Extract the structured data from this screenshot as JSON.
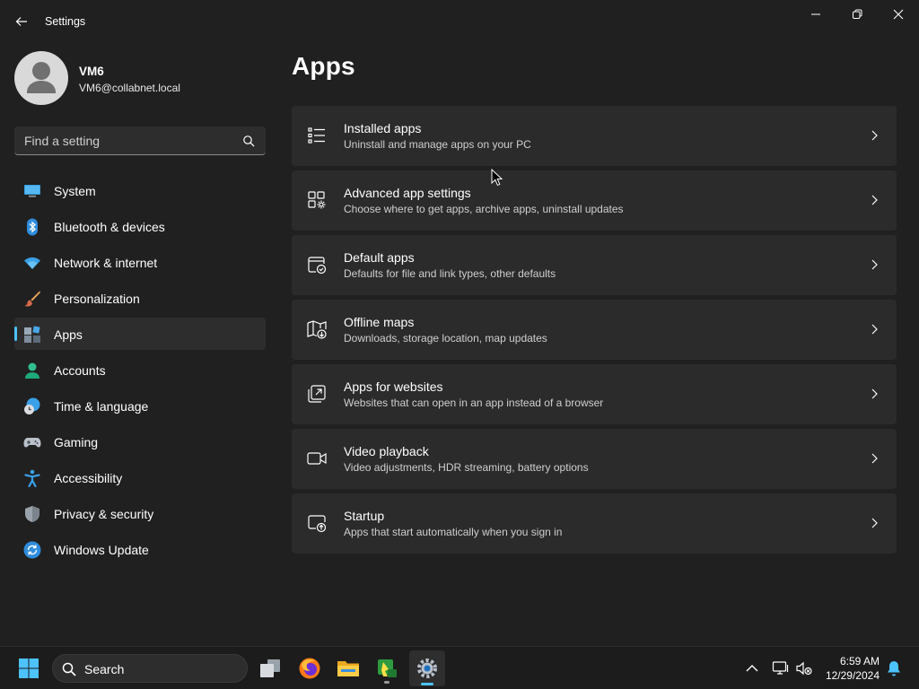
{
  "window": {
    "title": "Settings",
    "controls": [
      "minimize-icon",
      "restore-icon",
      "close-icon"
    ]
  },
  "profile": {
    "name": "VM6",
    "email": "VM6@collabnet.local"
  },
  "search": {
    "placeholder": "Find a setting"
  },
  "nav": {
    "items": [
      {
        "label": "System",
        "icon": "system-icon"
      },
      {
        "label": "Bluetooth & devices",
        "icon": "bluetooth-icon"
      },
      {
        "label": "Network & internet",
        "icon": "wifi-icon"
      },
      {
        "label": "Personalization",
        "icon": "paintbrush-icon"
      },
      {
        "label": "Apps",
        "icon": "apps-icon",
        "selected": true
      },
      {
        "label": "Accounts",
        "icon": "accounts-icon"
      },
      {
        "label": "Time & language",
        "icon": "time-language-icon"
      },
      {
        "label": "Gaming",
        "icon": "gamepad-icon"
      },
      {
        "label": "Accessibility",
        "icon": "accessibility-icon"
      },
      {
        "label": "Privacy & security",
        "icon": "shield-icon"
      },
      {
        "label": "Windows Update",
        "icon": "windows-update-icon"
      }
    ]
  },
  "main": {
    "title": "Apps",
    "cards": [
      {
        "title": "Installed apps",
        "description": "Uninstall and manage apps on your PC",
        "icon": "installed-apps-icon"
      },
      {
        "title": "Advanced app settings",
        "description": "Choose where to get apps, archive apps, uninstall updates",
        "icon": "advanced-app-settings-icon"
      },
      {
        "title": "Default apps",
        "description": "Defaults for file and link types, other defaults",
        "icon": "default-apps-icon"
      },
      {
        "title": "Offline maps",
        "description": "Downloads, storage location, map updates",
        "icon": "offline-maps-icon"
      },
      {
        "title": "Apps for websites",
        "description": "Websites that can open in an app instead of a browser",
        "icon": "apps-for-websites-icon"
      },
      {
        "title": "Video playback",
        "description": "Video adjustments, HDR streaming, battery options",
        "icon": "video-icon"
      },
      {
        "title": "Startup",
        "description": "Apps that start automatically when you sign in",
        "icon": "startup-icon"
      }
    ]
  },
  "taskbar": {
    "search_label": "Search",
    "apps": [
      "task-view-icon",
      "firefox-icon",
      "file-explorer-icon",
      "green-app-icon",
      "settings-icon"
    ],
    "time": "6:59 AM",
    "date": "12/29/2024"
  },
  "colors": {
    "background": "#202020",
    "card": "#2b2b2b",
    "accent": "#4cc2ff",
    "taskbar": "#1c1c1c"
  }
}
